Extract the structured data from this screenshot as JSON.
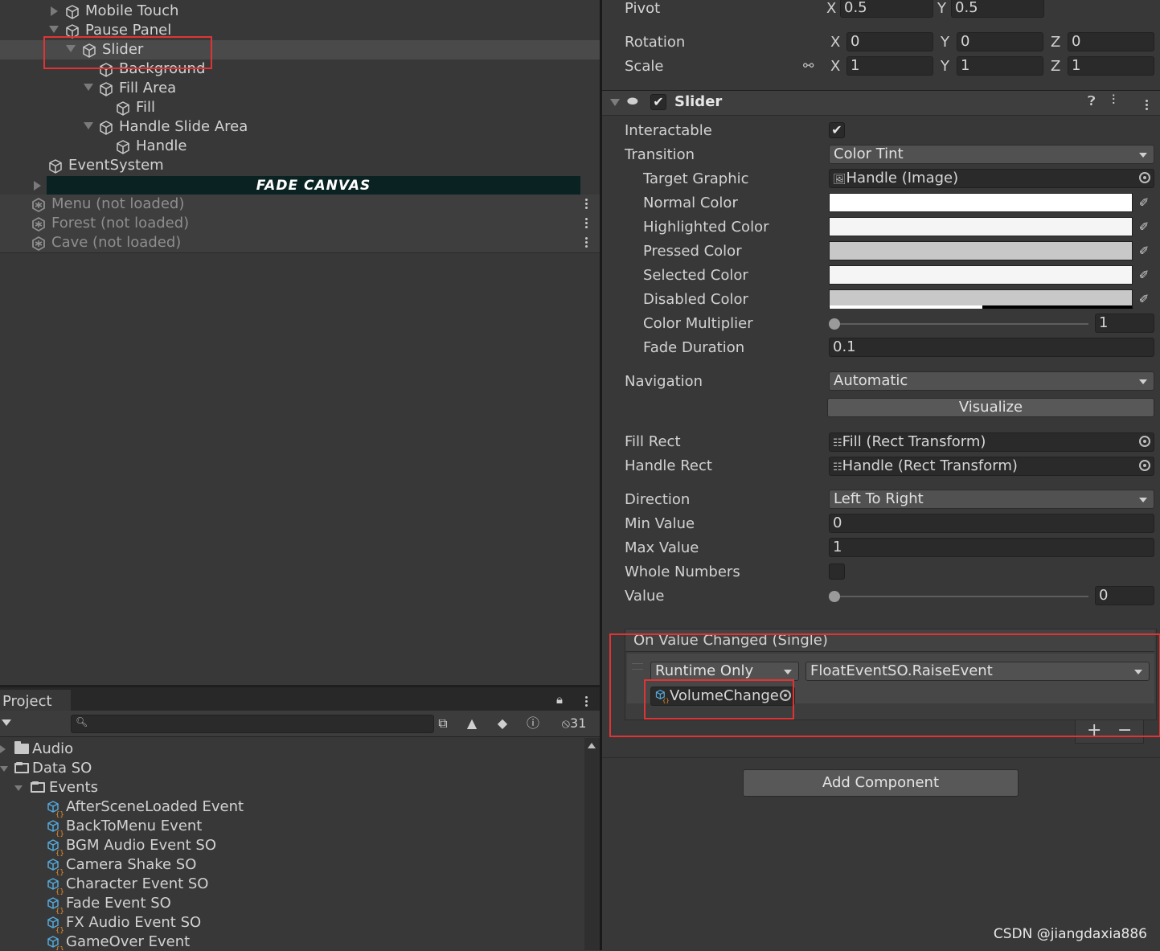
{
  "hierarchy": {
    "items": [
      {
        "label": "Mobile Touch"
      },
      {
        "label": "Pause Panel"
      },
      {
        "label": "Slider"
      },
      {
        "label": "Background"
      },
      {
        "label": "Fill Area"
      },
      {
        "label": "Fill"
      },
      {
        "label": "Handle Slide Area"
      },
      {
        "label": "Handle"
      },
      {
        "label": "EventSystem"
      }
    ],
    "fade_canvas": "FADE CANVAS",
    "scenes": [
      {
        "label": "Menu (not loaded)"
      },
      {
        "label": "Forest (not loaded)"
      },
      {
        "label": "Cave (not loaded)"
      }
    ]
  },
  "project": {
    "tab_label": "Project",
    "search_placeholder": "",
    "hidden_count": "31",
    "folders": [
      {
        "label": "Audio"
      },
      {
        "label": "Data SO"
      },
      {
        "label": "Events"
      }
    ],
    "assets": [
      {
        "label": "AfterSceneLoaded Event"
      },
      {
        "label": "BackToMenu Event"
      },
      {
        "label": "BGM Audio Event SO"
      },
      {
        "label": "Camera Shake SO"
      },
      {
        "label": "Character Event SO"
      },
      {
        "label": "Fade Event SO"
      },
      {
        "label": "FX Audio Event SO"
      },
      {
        "label": "GameOver Event"
      }
    ]
  },
  "inspector": {
    "transform": {
      "pivot_label": "Pivot",
      "pivot_x": "0.5",
      "pivot_y": "0.5",
      "rotation_label": "Rotation",
      "rotation": {
        "x": "0",
        "y": "0",
        "z": "0"
      },
      "scale_label": "Scale",
      "scale": {
        "x": "1",
        "y": "1",
        "z": "1"
      },
      "axis_x": "X",
      "axis_y": "Y",
      "axis_z": "Z"
    },
    "component_title": "Slider",
    "properties": {
      "interactable_label": "Interactable",
      "transition_label": "Transition",
      "transition_value": "Color Tint",
      "target_graphic_label": "Target Graphic",
      "target_graphic_value": "Handle (Image)",
      "normal_color_label": "Normal Color",
      "highlighted_color_label": "Highlighted Color",
      "pressed_color_label": "Pressed Color",
      "selected_color_label": "Selected Color",
      "disabled_color_label": "Disabled Color",
      "color_multiplier_label": "Color Multiplier",
      "color_multiplier_value": "1",
      "fade_duration_label": "Fade Duration",
      "fade_duration_value": "0.1",
      "navigation_label": "Navigation",
      "navigation_value": "Automatic",
      "visualize_label": "Visualize",
      "fill_rect_label": "Fill Rect",
      "fill_rect_value": "Fill (Rect Transform)",
      "handle_rect_label": "Handle Rect",
      "handle_rect_value": "Handle (Rect Transform)",
      "direction_label": "Direction",
      "direction_value": "Left To Right",
      "min_value_label": "Min Value",
      "min_value": "0",
      "max_value_label": "Max Value",
      "max_value": "1",
      "whole_numbers_label": "Whole Numbers",
      "value_label": "Value",
      "value": "0"
    },
    "colors": {
      "normal": "#ffffff",
      "highlighted": "#f5f5f5",
      "pressed": "#c8c8c8",
      "selected": "#f5f5f5",
      "disabled": "#c8c8c8"
    },
    "event": {
      "header": "On Value Changed (Single)",
      "runtime": "Runtime Only",
      "function": "FloatEventSO.RaiseEvent",
      "target_object": "VolumeChange"
    },
    "add_component_label": "Add Component"
  },
  "watermark": "CSDN @jiangdaxia886",
  "accent": {
    "highlight_box": "#e03434",
    "fade_canvas_bg": "#0a2222"
  }
}
